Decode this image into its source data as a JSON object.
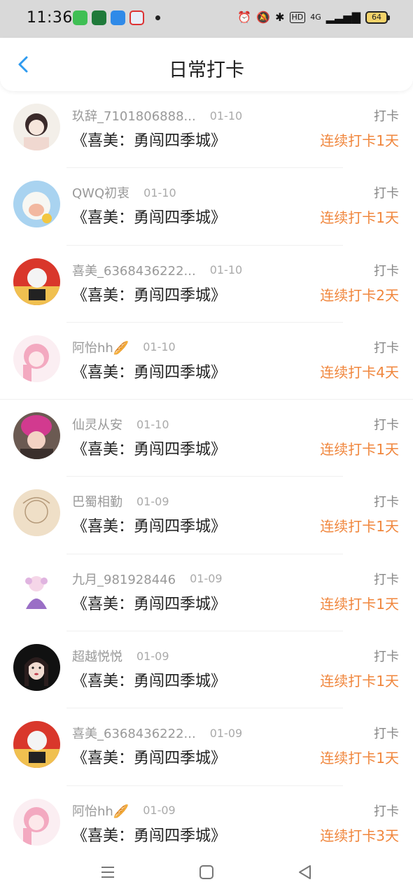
{
  "status_bar": {
    "time": "11:36",
    "battery": "64",
    "network": "4G",
    "icons": [
      "alarm-icon",
      "mute-icon",
      "bluetooth-icon",
      "hd-icon",
      "signal-icon",
      "battery-icon"
    ]
  },
  "header": {
    "title": "日常打卡",
    "back_icon": "chevron-left-icon"
  },
  "records": [
    {
      "user": "玖辞_7101806888...",
      "date": "01-10",
      "label": "打卡",
      "book": "《喜美：勇闯四季城》",
      "streak": "连续打卡1天",
      "avatar": "girl-sketch"
    },
    {
      "user": "QWQ初衷",
      "date": "01-10",
      "label": "打卡",
      "book": "《喜美：勇闯四季城》",
      "streak": "连续打卡1天",
      "avatar": "sheep"
    },
    {
      "user": "喜美_6368436222...",
      "date": "01-10",
      "label": "打卡",
      "book": "《喜美：勇闯四季城》",
      "streak": "连续打卡2天",
      "avatar": "red-cartoon"
    },
    {
      "user": "阿怡hh🥖",
      "date": "01-10",
      "label": "打卡",
      "book": "《喜美：勇闯四季城》",
      "streak": "连续打卡4天",
      "avatar": "pink-anime"
    },
    {
      "user": "仙灵从安",
      "date": "01-10",
      "label": "打卡",
      "book": "《喜美：勇闯四季城》",
      "streak": "连续打卡1天",
      "avatar": "pink-hat"
    },
    {
      "user": "巴蜀相勤",
      "date": "01-09",
      "label": "打卡",
      "book": "《喜美：勇闯四季城》",
      "streak": "连续打卡1天",
      "avatar": "beige-sketch"
    },
    {
      "user": "九月_981928446",
      "date": "01-09",
      "label": "打卡",
      "book": "《喜美：勇闯四季城》",
      "streak": "连续打卡1天",
      "avatar": "purple-chibi"
    },
    {
      "user": "超越悦悦",
      "date": "01-09",
      "label": "打卡",
      "book": "《喜美：勇闯四季城》",
      "streak": "连续打卡1天",
      "avatar": "dark-girl"
    },
    {
      "user": "喜美_6368436222...",
      "date": "01-09",
      "label": "打卡",
      "book": "《喜美：勇闯四季城》",
      "streak": "连续打卡1天",
      "avatar": "red-cartoon"
    },
    {
      "user": "阿怡hh🥖",
      "date": "01-09",
      "label": "打卡",
      "book": "《喜美：勇闯四季城》",
      "streak": "连续打卡3天",
      "avatar": "pink-anime"
    }
  ],
  "colors": {
    "accent": "#f0863c",
    "back_arrow": "#2f9bf0"
  },
  "nav_bar": [
    "menu-icon",
    "home-icon",
    "back-icon"
  ]
}
